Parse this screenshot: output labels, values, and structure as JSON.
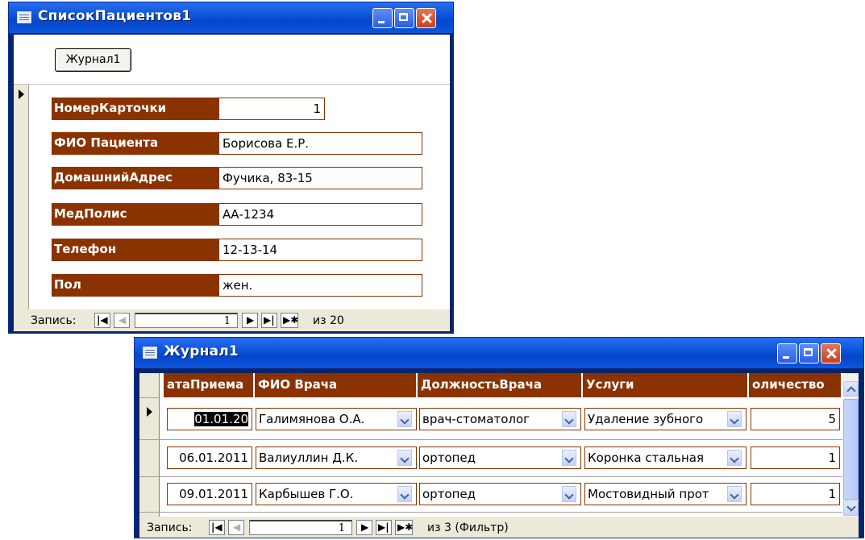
{
  "window1": {
    "title": "СписокПациентов1",
    "journal_button": "Журнал1",
    "fields": [
      {
        "label": "НомерКарточки",
        "value": "1"
      },
      {
        "label": "ФИО Пациента",
        "value": "Борисова Е.Р."
      },
      {
        "label": "ДомашнийАдрес",
        "value": "Фучика, 83-15"
      },
      {
        "label": "МедПолис",
        "value": "АА-1234"
      },
      {
        "label": "Телефон",
        "value": "12-13-14"
      },
      {
        "label": "Пол",
        "value": "жен."
      }
    ],
    "nav": {
      "label": "Запись:",
      "current": "1",
      "total": "из 20"
    }
  },
  "window2": {
    "title": "Журнал1",
    "columns": [
      "атаПриема",
      "ФИО Врача",
      "ДолжностьВрача",
      "Услуги",
      "оличество"
    ],
    "rows": [
      {
        "date": "01.01.20",
        "doctor": "Галимянова О.А.",
        "position": "врач-стоматолог",
        "service": "Удаление зубного",
        "qty": "5"
      },
      {
        "date": "06.01.2011",
        "doctor": "Валиуллин Д.К.",
        "position": "ортопед",
        "service": "Коронка стальная",
        "qty": "1"
      },
      {
        "date": "09.01.2011",
        "doctor": "Карбышев Г.О.",
        "position": "ортопед",
        "service": "Мостовидный прот",
        "qty": "1"
      }
    ],
    "nav": {
      "label": "Запись:",
      "current": "1",
      "total": "из 3 (Фильтр)"
    }
  },
  "colors": {
    "accent": "#8B3300",
    "titlebar": "#0A52D8",
    "chrome": "#ECE9D8"
  },
  "nav_icons": [
    "first-record-icon",
    "prev-record-icon",
    "next-record-icon",
    "last-record-icon",
    "new-record-icon"
  ]
}
